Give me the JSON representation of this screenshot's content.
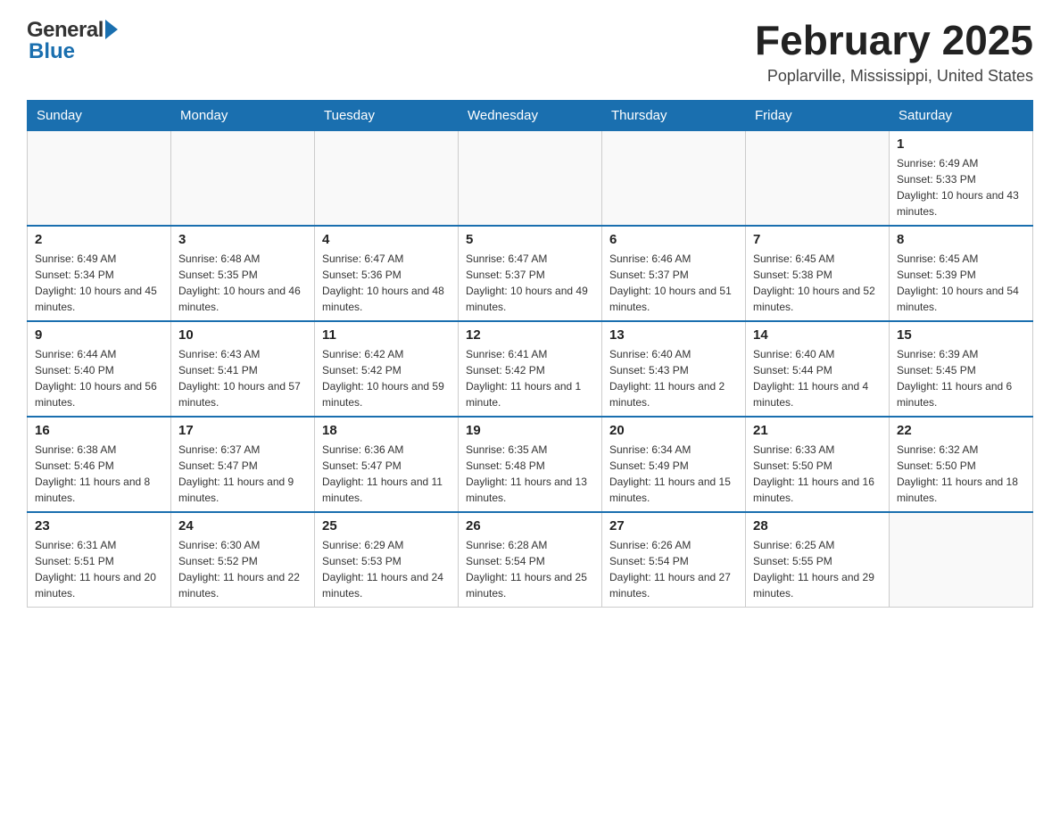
{
  "header": {
    "logo_general": "General",
    "logo_blue": "Blue",
    "month_title": "February 2025",
    "location": "Poplarville, Mississippi, United States"
  },
  "days_of_week": [
    "Sunday",
    "Monday",
    "Tuesday",
    "Wednesday",
    "Thursday",
    "Friday",
    "Saturday"
  ],
  "weeks": [
    {
      "days": [
        {
          "num": "",
          "info": ""
        },
        {
          "num": "",
          "info": ""
        },
        {
          "num": "",
          "info": ""
        },
        {
          "num": "",
          "info": ""
        },
        {
          "num": "",
          "info": ""
        },
        {
          "num": "",
          "info": ""
        },
        {
          "num": "1",
          "info": "Sunrise: 6:49 AM\nSunset: 5:33 PM\nDaylight: 10 hours and 43 minutes."
        }
      ]
    },
    {
      "days": [
        {
          "num": "2",
          "info": "Sunrise: 6:49 AM\nSunset: 5:34 PM\nDaylight: 10 hours and 45 minutes."
        },
        {
          "num": "3",
          "info": "Sunrise: 6:48 AM\nSunset: 5:35 PM\nDaylight: 10 hours and 46 minutes."
        },
        {
          "num": "4",
          "info": "Sunrise: 6:47 AM\nSunset: 5:36 PM\nDaylight: 10 hours and 48 minutes."
        },
        {
          "num": "5",
          "info": "Sunrise: 6:47 AM\nSunset: 5:37 PM\nDaylight: 10 hours and 49 minutes."
        },
        {
          "num": "6",
          "info": "Sunrise: 6:46 AM\nSunset: 5:37 PM\nDaylight: 10 hours and 51 minutes."
        },
        {
          "num": "7",
          "info": "Sunrise: 6:45 AM\nSunset: 5:38 PM\nDaylight: 10 hours and 52 minutes."
        },
        {
          "num": "8",
          "info": "Sunrise: 6:45 AM\nSunset: 5:39 PM\nDaylight: 10 hours and 54 minutes."
        }
      ]
    },
    {
      "days": [
        {
          "num": "9",
          "info": "Sunrise: 6:44 AM\nSunset: 5:40 PM\nDaylight: 10 hours and 56 minutes."
        },
        {
          "num": "10",
          "info": "Sunrise: 6:43 AM\nSunset: 5:41 PM\nDaylight: 10 hours and 57 minutes."
        },
        {
          "num": "11",
          "info": "Sunrise: 6:42 AM\nSunset: 5:42 PM\nDaylight: 10 hours and 59 minutes."
        },
        {
          "num": "12",
          "info": "Sunrise: 6:41 AM\nSunset: 5:42 PM\nDaylight: 11 hours and 1 minute."
        },
        {
          "num": "13",
          "info": "Sunrise: 6:40 AM\nSunset: 5:43 PM\nDaylight: 11 hours and 2 minutes."
        },
        {
          "num": "14",
          "info": "Sunrise: 6:40 AM\nSunset: 5:44 PM\nDaylight: 11 hours and 4 minutes."
        },
        {
          "num": "15",
          "info": "Sunrise: 6:39 AM\nSunset: 5:45 PM\nDaylight: 11 hours and 6 minutes."
        }
      ]
    },
    {
      "days": [
        {
          "num": "16",
          "info": "Sunrise: 6:38 AM\nSunset: 5:46 PM\nDaylight: 11 hours and 8 minutes."
        },
        {
          "num": "17",
          "info": "Sunrise: 6:37 AM\nSunset: 5:47 PM\nDaylight: 11 hours and 9 minutes."
        },
        {
          "num": "18",
          "info": "Sunrise: 6:36 AM\nSunset: 5:47 PM\nDaylight: 11 hours and 11 minutes."
        },
        {
          "num": "19",
          "info": "Sunrise: 6:35 AM\nSunset: 5:48 PM\nDaylight: 11 hours and 13 minutes."
        },
        {
          "num": "20",
          "info": "Sunrise: 6:34 AM\nSunset: 5:49 PM\nDaylight: 11 hours and 15 minutes."
        },
        {
          "num": "21",
          "info": "Sunrise: 6:33 AM\nSunset: 5:50 PM\nDaylight: 11 hours and 16 minutes."
        },
        {
          "num": "22",
          "info": "Sunrise: 6:32 AM\nSunset: 5:50 PM\nDaylight: 11 hours and 18 minutes."
        }
      ]
    },
    {
      "days": [
        {
          "num": "23",
          "info": "Sunrise: 6:31 AM\nSunset: 5:51 PM\nDaylight: 11 hours and 20 minutes."
        },
        {
          "num": "24",
          "info": "Sunrise: 6:30 AM\nSunset: 5:52 PM\nDaylight: 11 hours and 22 minutes."
        },
        {
          "num": "25",
          "info": "Sunrise: 6:29 AM\nSunset: 5:53 PM\nDaylight: 11 hours and 24 minutes."
        },
        {
          "num": "26",
          "info": "Sunrise: 6:28 AM\nSunset: 5:54 PM\nDaylight: 11 hours and 25 minutes."
        },
        {
          "num": "27",
          "info": "Sunrise: 6:26 AM\nSunset: 5:54 PM\nDaylight: 11 hours and 27 minutes."
        },
        {
          "num": "28",
          "info": "Sunrise: 6:25 AM\nSunset: 5:55 PM\nDaylight: 11 hours and 29 minutes."
        },
        {
          "num": "",
          "info": ""
        }
      ]
    }
  ]
}
